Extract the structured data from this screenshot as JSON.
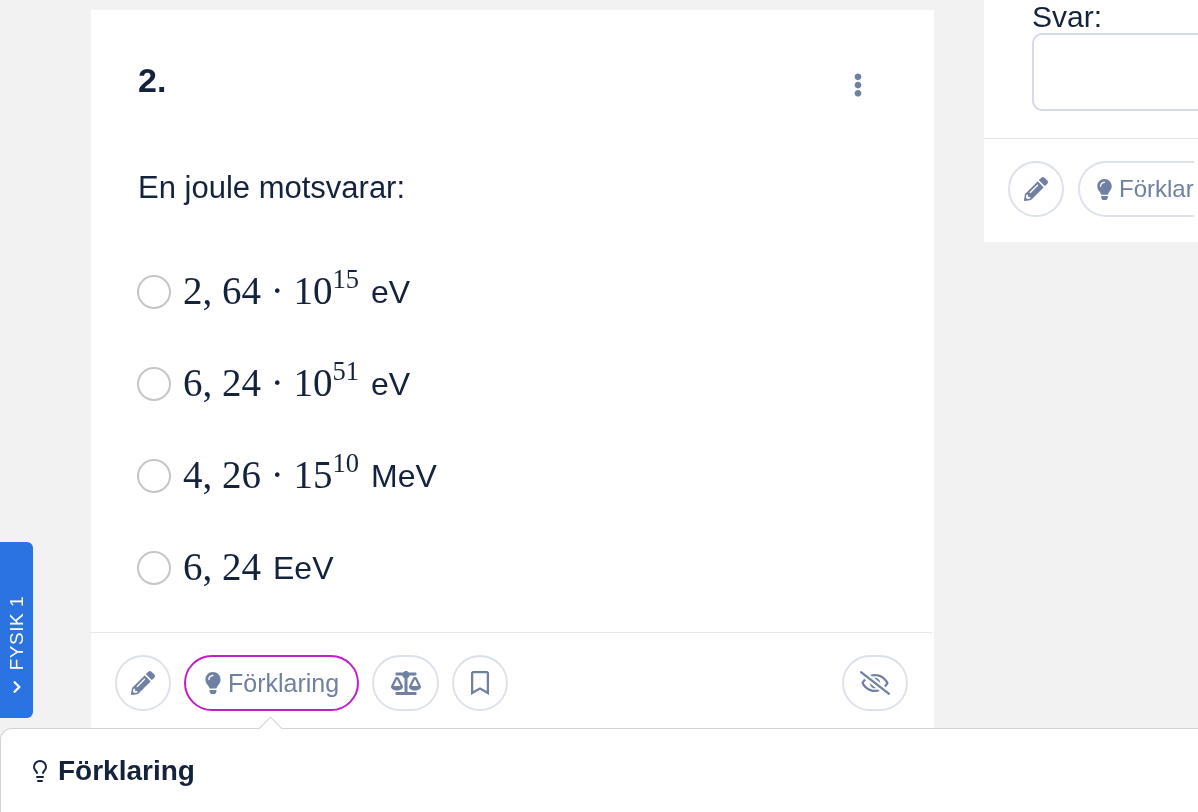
{
  "side_tab": {
    "label": "FYSIK 1"
  },
  "question": {
    "number": "2.",
    "prompt": "En joule motsvarar:",
    "options": [
      {
        "value": "2, 64 · 10$^{15}$",
        "unit": "eV",
        "selected": false
      },
      {
        "value": "6, 24 · 10$^{51}$",
        "unit": "eV",
        "selected": false
      },
      {
        "value": "4, 26 · 15$^{10}$",
        "unit": "MeV",
        "selected": false
      },
      {
        "value": "6, 24",
        "unit": "EeV",
        "selected": false
      }
    ],
    "toolbar": [
      {
        "kind": "edit"
      },
      {
        "kind": "explanation",
        "label": "Förklaring",
        "active": true
      },
      {
        "kind": "compare"
      },
      {
        "kind": "bookmark"
      },
      {
        "kind": "hide"
      }
    ]
  },
  "explanation_panel": {
    "title": "Förklaring"
  },
  "next_card": {
    "answer_label": "Svar:",
    "toolbar": [
      {
        "kind": "edit"
      },
      {
        "kind": "explanation",
        "label": "Förklar",
        "active": false
      }
    ]
  }
}
